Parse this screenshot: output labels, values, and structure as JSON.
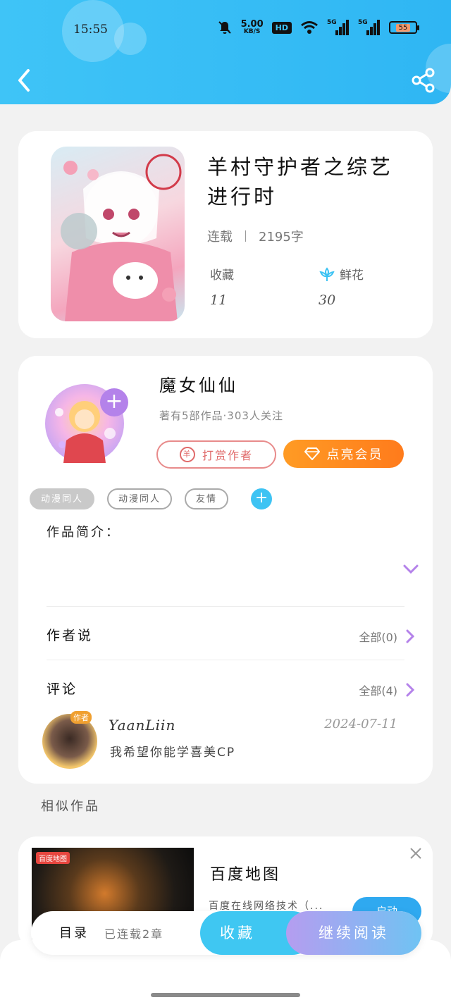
{
  "status_bar": {
    "time": "15:55",
    "net_speed_value": "5.00",
    "net_speed_unit": "KB/S",
    "hd_label": "HD",
    "signal_1_label": "5G",
    "signal_2_label": "5G",
    "battery_level": "55"
  },
  "book": {
    "title": "羊村守护者之综艺进行时",
    "status": "连载",
    "word_count": "2195字",
    "favorites_label": "收藏",
    "favorites_count": "11",
    "flowers_label": "鲜花",
    "flowers_count": "30"
  },
  "author": {
    "name": "魔女仙仙",
    "meta": "著有5部作品·303人关注",
    "reward_label": "打赏作者",
    "reward_coin": "羊",
    "vip_label": "点亮会员",
    "tags": [
      "动漫同人",
      "动漫同人",
      "友情"
    ],
    "intro_label": "作品简介："
  },
  "author_says": {
    "label": "作者说",
    "all_label": "全部(0)"
  },
  "comments": {
    "label": "评论",
    "all_label": "全部(4)",
    "items": [
      {
        "badge": "作者",
        "user": "YaanLiin",
        "date": "2024-07-11",
        "text": "我希望你能学喜美CP"
      }
    ]
  },
  "similar": {
    "label": "相似作品",
    "ad": {
      "logo": "百度地图",
      "title": "百度地图",
      "desc": "百度在线网络技术（...",
      "cta": "启动"
    }
  },
  "bottom_bar": {
    "toc_label": "目录",
    "toc_progress": "已连载2章",
    "favorite_label": "收藏",
    "continue_label": "继续阅读"
  },
  "colors": {
    "header": "#3fc4f7",
    "vip": "#ff8a1f",
    "accent_purple": "#b482ea",
    "reward": "#e06a6a"
  },
  "icons": [
    "back-arrow-icon",
    "share-icon",
    "flower-icon",
    "chevron-down-icon",
    "chevron-right-icon",
    "diamond-icon",
    "close-icon",
    "plus-icon"
  ]
}
